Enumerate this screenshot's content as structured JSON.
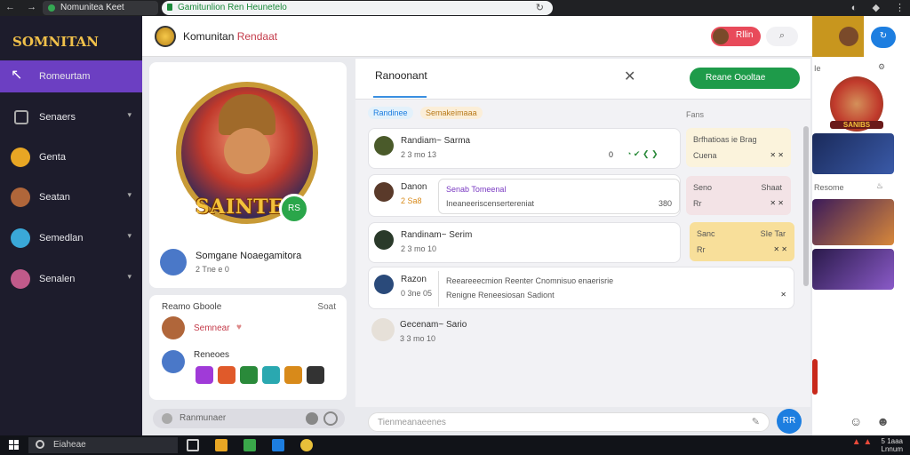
{
  "browser": {
    "nav_back": "←",
    "nav_fwd": "→",
    "tab_title": "Nomunitea Keet",
    "url": "Gamitunlion Ren Heunetelo",
    "refresh": "↻",
    "tray_icons": [
      "◐",
      "◆",
      "⋮"
    ]
  },
  "sidebar": {
    "logo": "SOMNITAN",
    "items": [
      {
        "label": "Romeurtam",
        "active": true
      },
      {
        "label": "Senaers"
      },
      {
        "label": "Genta"
      },
      {
        "label": "Seatan"
      },
      {
        "label": "Semedlan"
      },
      {
        "label": "Senalen"
      }
    ]
  },
  "header": {
    "title_main": "Komunitan",
    "title_accent": "Rendaat",
    "badge": "Rllin",
    "search_icon": "⌕"
  },
  "profile": {
    "banner": "SAINTER",
    "badge": "RS",
    "name": "Somgane Noaegamitora",
    "sub": "2 Tne e 0"
  },
  "friends": {
    "title": "Reamo Gboole",
    "link": "Soat",
    "f1": "Semnear",
    "f2": "Reneoes",
    "search_placeholder": "Ranmunaer"
  },
  "main": {
    "tab": "Ranoonant",
    "close": "✕",
    "button": "Reane Oooltae",
    "filter1": "Randinee",
    "filter2": "Semakeimaaa",
    "filter_right": "Fans",
    "rows": [
      {
        "name": "Randiam~ Sarma",
        "sub": "2 3 mo 13",
        "right": "0",
        "icons": "◔ ✔ ❮ ❯"
      },
      {
        "name": "Danon",
        "sub": "2 Sa8",
        "bubble_title": "Senab Tomeenal",
        "bubble_text": "Ineaneeriscensertereniat",
        "bubble_right": "380"
      },
      {
        "name": "Randinam~ Serim",
        "sub": "2 3 mo 10"
      },
      {
        "name": "Razon",
        "sub": "0 3ne 05",
        "bubble_title": "Reeareeecmion Reenter Cnomnisuo enaerisrie",
        "bubble_text": "Renigne Reneesiosan Sadiont"
      },
      {
        "name": "Gecenam~ Sario",
        "sub": "3 3 mo 10"
      }
    ],
    "cards": [
      {
        "title": "Brfhatioas ie Brag",
        "bottom": "Cuena"
      },
      {
        "title": "Seno",
        "right": "Shaat",
        "bottom": "Rr"
      },
      {
        "title": "Sanc",
        "right": "SIe Tar",
        "bottom": "Rr"
      }
    ],
    "input_placeholder": "Tienmeanaeenes",
    "send": "RR"
  },
  "right": {
    "rh_btn": "↻",
    "lbl1": "Ie",
    "lbl2": "Resome",
    "thumb_text": "SANIBS"
  },
  "taskbar": {
    "search": "Eiaheae",
    "time": "5 1aaa",
    "date": "Lnnum"
  },
  "colors": {
    "accent_purple": "#6c3fc2",
    "accent_green": "#1e9b4a",
    "accent_blue": "#1d7ee0",
    "sidebar_bg": "#1d1c2c"
  }
}
